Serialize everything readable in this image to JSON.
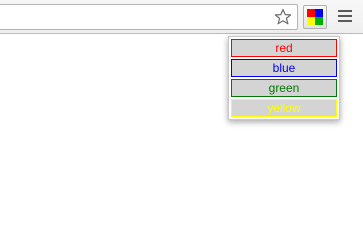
{
  "toolbar": {
    "star_icon": "star-icon",
    "extension_icon": "color-quadrant-icon",
    "menu_icon": "hamburger-menu-icon"
  },
  "extension_icon_colors": [
    "#ff0000",
    "#0000ff",
    "#ffff00",
    "#00b000"
  ],
  "popup": {
    "buttons": [
      {
        "label": "red",
        "color": "#ff0000"
      },
      {
        "label": "blue",
        "color": "#0000ff"
      },
      {
        "label": "green",
        "color": "#007a00"
      },
      {
        "label": "yellow",
        "color": "#ffff00"
      }
    ]
  }
}
